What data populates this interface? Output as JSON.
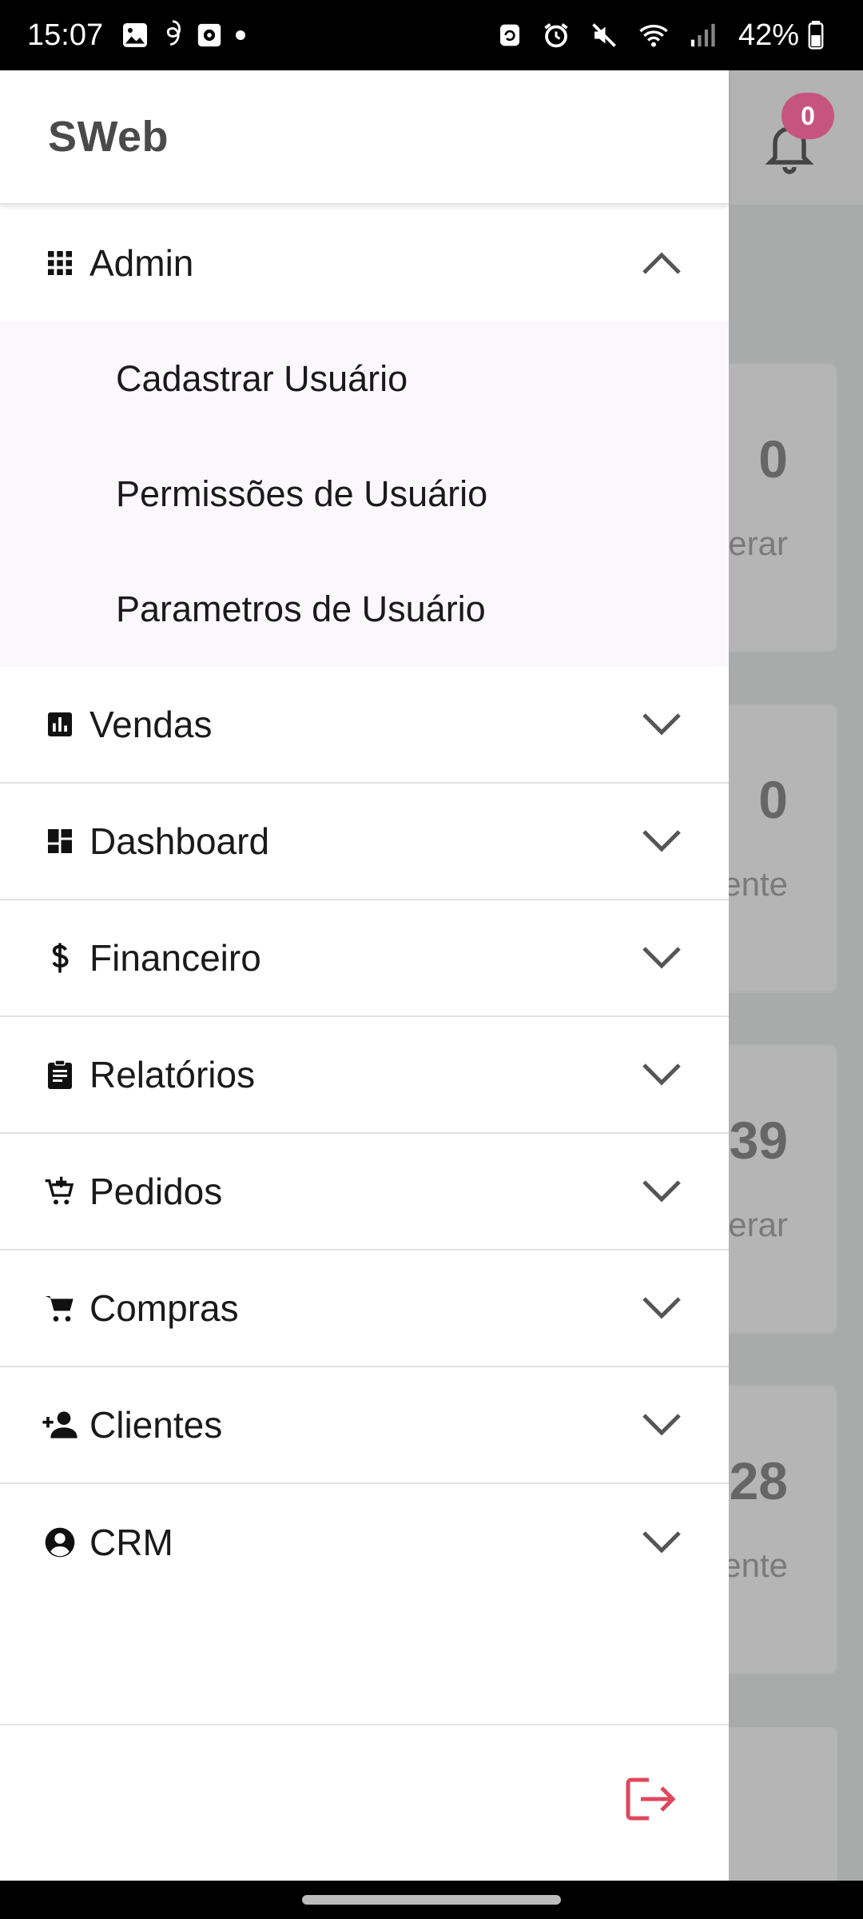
{
  "status_bar": {
    "time": "15:07",
    "battery": "42%",
    "left_icons": [
      "gallery-icon",
      "threads-icon",
      "screen-recorder-icon",
      "dot-icon"
    ],
    "right_icons": [
      "lock-rotate-icon",
      "alarm-icon",
      "mute-icon",
      "wifi-icon",
      "signal-icon",
      "battery-icon"
    ]
  },
  "background_app": {
    "notification_count": "0",
    "cards": [
      {
        "value": "0",
        "label": "erar"
      },
      {
        "value": "0",
        "label": "ente"
      },
      {
        "value": "39",
        "label": "erar"
      },
      {
        "value": "28",
        "label": "ente"
      }
    ]
  },
  "drawer": {
    "title": "SWeb",
    "menu": [
      {
        "label": "Admin",
        "icon": "apps-grid-icon",
        "expanded": true,
        "children": [
          "Cadastrar Usuário",
          "Permissões de Usuário",
          "Parametros de Usuário"
        ]
      },
      {
        "label": "Vendas",
        "icon": "bar-chart-icon"
      },
      {
        "label": "Dashboard",
        "icon": "dashboard-icon"
      },
      {
        "label": "Financeiro",
        "icon": "dollar-icon"
      },
      {
        "label": "Relatórios",
        "icon": "clipboard-icon"
      },
      {
        "label": "Pedidos",
        "icon": "add-cart-icon"
      },
      {
        "label": "Compras",
        "icon": "cart-icon"
      },
      {
        "label": "Clientes",
        "icon": "add-person-icon"
      },
      {
        "label": "CRM",
        "icon": "account-circle-icon"
      }
    ],
    "logout_icon": "logout-icon",
    "logout_color": "#e0475d"
  }
}
